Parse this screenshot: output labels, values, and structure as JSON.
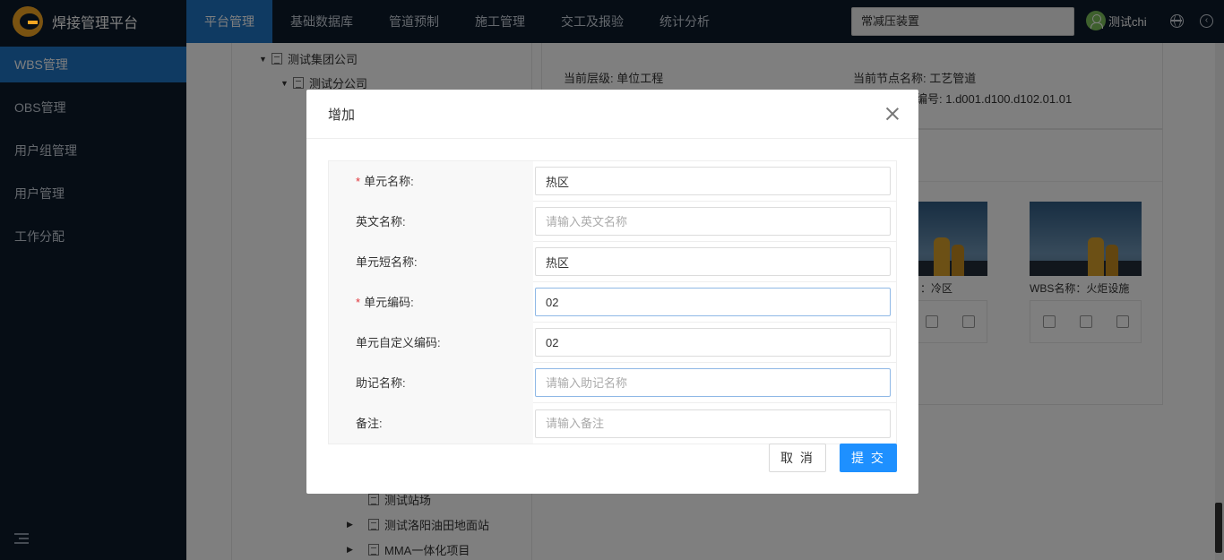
{
  "app": {
    "title": "焊接管理平台"
  },
  "nav": {
    "items": [
      "平台管理",
      "基础数据库",
      "管道预制",
      "施工管理",
      "交工及报验",
      "统计分析"
    ]
  },
  "header": {
    "search_value": "常减压装置",
    "user_name": "测试chi"
  },
  "sidebar": {
    "items": [
      "WBS管理",
      "OBS管理",
      "用户组管理",
      "用户管理",
      "工作分配"
    ]
  },
  "tree": {
    "top": [
      "测试集团公司",
      "测试分公司"
    ],
    "bottom": [
      "测试站场",
      "测试洛阳油田地面站",
      "MMA一体化项目"
    ]
  },
  "info": {
    "level": "当前层级: 单位工程",
    "node_name": "当前节点名称: 工艺管道",
    "code_partial": "编号: 1.d001.d100.d102.01.01"
  },
  "cards": [
    {
      "caption_partial": "：冷区"
    },
    {
      "caption": "WBS名称：火炬设施"
    }
  ],
  "modal": {
    "title": "增加",
    "fields": [
      {
        "label": "单元名称:",
        "required": true,
        "value": "热区",
        "placeholder": ""
      },
      {
        "label": "英文名称:",
        "required": false,
        "value": "",
        "placeholder": "请输入英文名称"
      },
      {
        "label": "单元短名称:",
        "required": false,
        "value": "热区",
        "placeholder": ""
      },
      {
        "label": "单元编码:",
        "required": true,
        "value": "02",
        "placeholder": ""
      },
      {
        "label": "单元自定义编码:",
        "required": false,
        "value": "02",
        "placeholder": ""
      },
      {
        "label": "助记名称:",
        "required": false,
        "value": "",
        "placeholder": "请输入助记名称"
      },
      {
        "label": "备注:",
        "required": false,
        "value": "",
        "placeholder": "请输入备注"
      }
    ],
    "cancel_label": "取 消",
    "submit_label": "提 交",
    "required_mark": "*"
  },
  "colors": {
    "nav_bg": "#0c1a2b",
    "active": "#1e74c5",
    "primary": "#1e90ff",
    "required": "#e0353b"
  }
}
